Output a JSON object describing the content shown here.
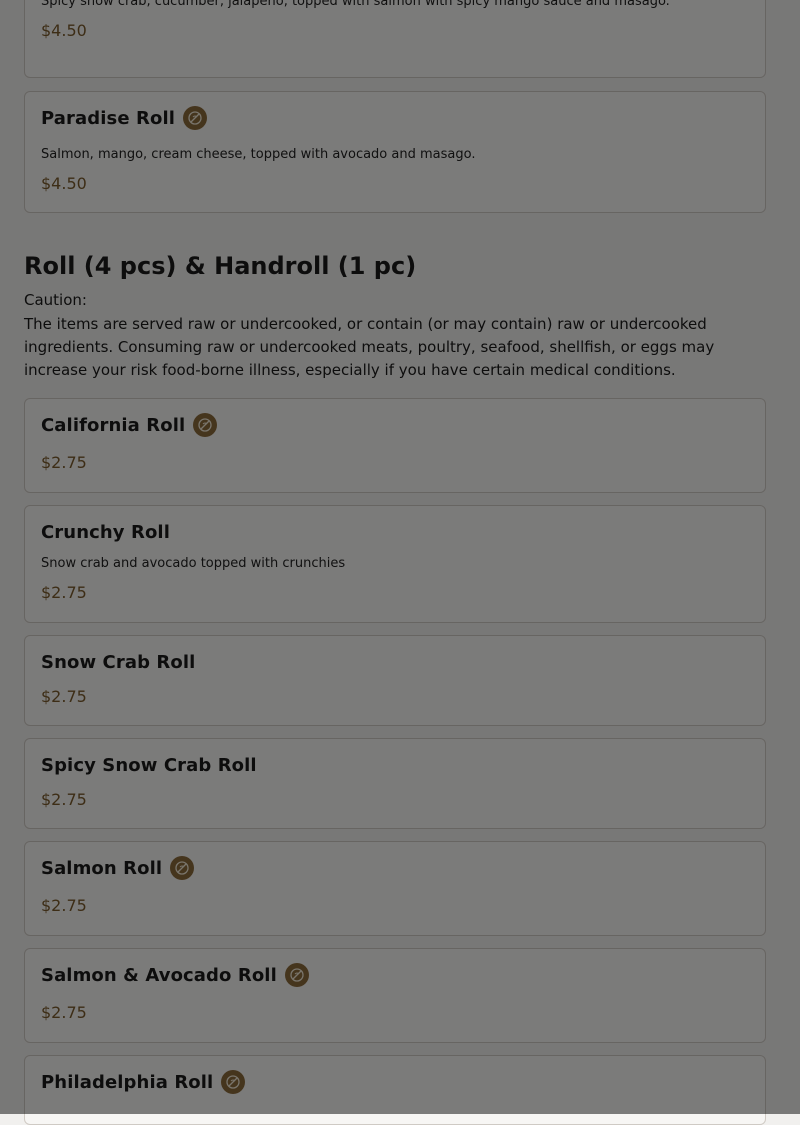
{
  "prev_item": {
    "desc": "Spicy snow crab, cucumber, jalapeño, topped with salmon with spicy mango sauce and masago.",
    "price": "$4.50"
  },
  "paradise": {
    "name": "Paradise Roll",
    "desc": "Salmon, mango, cream cheese, topped with avocado and masago.",
    "price": "$4.50"
  },
  "section": {
    "title": "Roll (4 pcs) & Handroll (1 pc)",
    "caution_label": "Caution:",
    "caution_text": "The items are served raw or undercooked, or contain (or may contain) raw or undercooked ingredients. Consuming raw or undercooked meats, poultry, seafood, shellfish, or eggs may increase your risk food-borne illness, especially if you have certain medical conditions."
  },
  "items": [
    {
      "name": "California Roll",
      "price": "$2.75",
      "badge": "no-gluten-icon"
    },
    {
      "name": "Crunchy Roll",
      "desc": "Snow crab and avocado topped with crunchies",
      "price": "$2.75"
    },
    {
      "name": "Snow Crab Roll",
      "price": "$2.75"
    },
    {
      "name": "Spicy Snow Crab Roll",
      "price": "$2.75"
    },
    {
      "name": "Salmon Roll",
      "price": "$2.75",
      "badge": "no-gluten-icon"
    },
    {
      "name": "Salmon & Avocado Roll",
      "price": "$2.75",
      "badge": "no-gluten-icon"
    },
    {
      "name": "Philadelphia Roll",
      "badge": "no-gluten-icon"
    }
  ],
  "colors": {
    "price": "#7a5b2c",
    "badge": "#8b6b3a",
    "overlay": "rgba(0,0,0,0.50)"
  }
}
